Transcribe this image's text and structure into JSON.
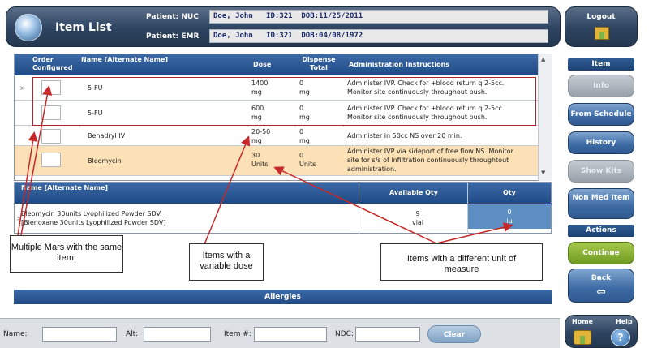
{
  "header": {
    "title": "Item List",
    "patient_nuc_label": "Patient: NUC",
    "patient_nuc_value": "Doe, John   ID:321  DOB:11/25/2011",
    "patient_emr_label": "Patient: EMR",
    "patient_emr_value": "Doe, John   ID:321  DOB:04/08/1972"
  },
  "right_panel": {
    "logout": "Logout",
    "item_header": "Item",
    "info": "Info",
    "from_schedule": "From Schedule",
    "history": "History",
    "show_kits": "Show Kits",
    "non_med_item": "Non Med Item",
    "actions_header": "Actions",
    "continue": "Continue",
    "back": "Back",
    "home": "Home",
    "help": "Help"
  },
  "grid": {
    "headers": {
      "order_configured": "Order Configured",
      "name": "Name [Alternate Name]",
      "dose": "Dose",
      "dispense_total": "Dispense Total",
      "admin_instructions": "Administration Instructions"
    },
    "rows": [
      {
        "name": "5-FU",
        "dose": "1400",
        "dose_unit": "mg",
        "dispense": "0",
        "dispense_unit": "mg",
        "instr1": "Administer IVP. Check for +blood return q 2-5cc.",
        "instr2": "Monitor site continuously throughout push.",
        "instr3": ""
      },
      {
        "name": "5-FU",
        "dose": "600",
        "dose_unit": "mg",
        "dispense": "0",
        "dispense_unit": "mg",
        "instr1": "Administer IVP. Check for +blood return q 2-5cc.",
        "instr2": "Monitor site continuously throughout push.",
        "instr3": ""
      },
      {
        "name": "Benadryl IV",
        "dose": "20-50",
        "dose_unit": "mg",
        "dispense": "0",
        "dispense_unit": "mg",
        "instr1": "Administer in 50cc NS over 20 min.",
        "instr2": "",
        "instr3": ""
      },
      {
        "name": "Bleomycin",
        "dose": "30",
        "dose_unit": "Units",
        "dispense": "0",
        "dispense_unit": "Units",
        "instr1": "Administer IVP via sideport of free flow NS.  Monitor",
        "instr2": "site for s/s of infiltration continuously throughtout",
        "instr3": "administration."
      }
    ]
  },
  "secondary": {
    "headers": {
      "name": "Name [Alternate Name]",
      "available_qty": "Available Qty",
      "qty": "Qty"
    },
    "row": {
      "name1": "Bleomycin 30units Lyophilized Powder SDV",
      "name2": "[Blenoxane 30units Lyophilized Powder SDV]",
      "available": "9",
      "available_unit": "vial",
      "qty": "0",
      "qty_unit": "iu"
    }
  },
  "annotations": {
    "multiple_mars": "Multiple Mars with the same item.",
    "variable_dose": "Items with a variable dose",
    "unit_measure": "Items with a different unit of measure"
  },
  "allergies": "Allergies",
  "search": {
    "name_label": "Name:",
    "alt_label": "Alt:",
    "item_label": "Item #:",
    "ndc_label": "NDC:",
    "clear": "Clear"
  },
  "colors": {
    "accent_red": "#b4242c",
    "highlight_row": "#fbe1b5",
    "header_blue": "#1f4a86"
  }
}
